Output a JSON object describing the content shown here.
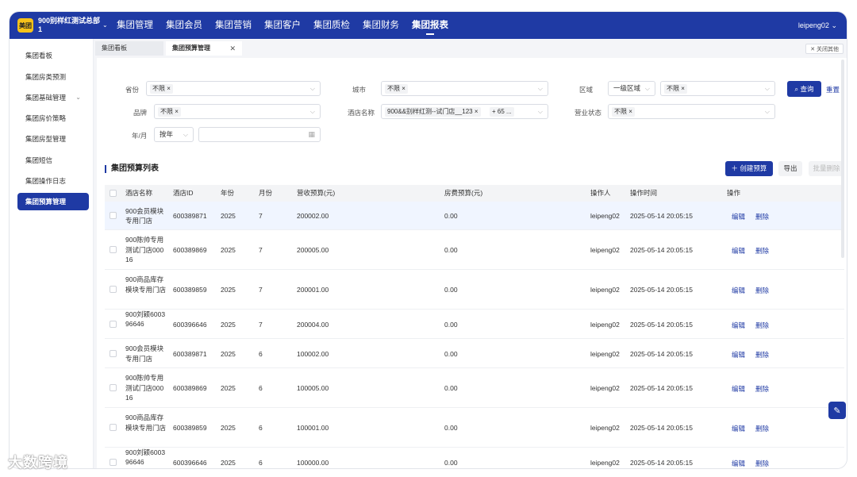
{
  "header": {
    "logo": "美团",
    "org": "900别样红测试总部1",
    "nav": [
      "集团管理",
      "集团会员",
      "集团营销",
      "集团客户",
      "集团质检",
      "集团财务",
      "集团报表"
    ],
    "active_nav": "集团报表",
    "user": "leipeng02",
    "accent": "#1f3aa4"
  },
  "sidebar": {
    "items": [
      "集团看板",
      "集团房类预测",
      "集团基础管理",
      "集团房价策略",
      "集团房型管理",
      "集团短信",
      "集团操作日志",
      "集团预算管理"
    ],
    "active": "集团预算管理"
  },
  "tabs": {
    "items": [
      "集团看板",
      "集团预算管理"
    ],
    "close_others": "关闭其他"
  },
  "filters": {
    "province_label": "省份",
    "province_value": "不限",
    "city_label": "城市",
    "city_value": "不限",
    "region_label": "区域",
    "region_level": "一级区域",
    "region_value": "不限",
    "brand_label": "品牌",
    "brand_value": "不限",
    "hotel_label": "酒店名称",
    "hotel_value": "900&&别样红测--试门店__123",
    "hotel_more": "+ 65 ...",
    "status_label": "营业状态",
    "status_value": "不限",
    "yearmonth_label": "年/月",
    "yearmonth_mode": "按年",
    "query_button": "查询",
    "reset_button": "重置"
  },
  "list": {
    "title": "集团预算列表",
    "create_button": "创建预算",
    "export_button": "导出",
    "batch_delete_button": "批量删除",
    "columns": [
      "酒店名称",
      "酒店ID",
      "年份",
      "月份",
      "营收预算(元)",
      "房费预算(元)",
      "操作人",
      "操作时间",
      "操作"
    ],
    "rows": [
      {
        "name": "900会员模块专用门店",
        "id": "600389871",
        "year": "2025",
        "month": "7",
        "revenue": "200002.00",
        "room": "0.00",
        "operator": "leipeng02",
        "time": "2025-05-14 20:05:15"
      },
      {
        "name": "900陈帅专用测试门店00016",
        "id": "600389869",
        "year": "2025",
        "month": "7",
        "revenue": "200005.00",
        "room": "0.00",
        "operator": "leipeng02",
        "time": "2025-05-14 20:05:15"
      },
      {
        "name": "900商品库存模块专用门店",
        "id": "600389859",
        "year": "2025",
        "month": "7",
        "revenue": "200001.00",
        "room": "0.00",
        "operator": "leipeng02",
        "time": "2025-05-14 20:05:15"
      },
      {
        "name": "900刘颖600396646",
        "id": "600396646",
        "year": "2025",
        "month": "7",
        "revenue": "200004.00",
        "room": "0.00",
        "operator": "leipeng02",
        "time": "2025-05-14 20:05:15"
      },
      {
        "name": "900会员模块专用门店",
        "id": "600389871",
        "year": "2025",
        "month": "6",
        "revenue": "100002.00",
        "room": "0.00",
        "operator": "leipeng02",
        "time": "2025-05-14 20:05:15"
      },
      {
        "name": "900陈帅专用测试门店00016",
        "id": "600389869",
        "year": "2025",
        "month": "6",
        "revenue": "100005.00",
        "room": "0.00",
        "operator": "leipeng02",
        "time": "2025-05-14 20:05:15"
      },
      {
        "name": "900商品库存模块专用门店",
        "id": "600389859",
        "year": "2025",
        "month": "6",
        "revenue": "100001.00",
        "room": "0.00",
        "operator": "leipeng02",
        "time": "2025-05-14 20:05:15"
      },
      {
        "name": "900刘颖600396646",
        "id": "600396646",
        "year": "2025",
        "month": "6",
        "revenue": "100000.00",
        "room": "0.00",
        "operator": "leipeng02",
        "time": "2025-05-14 20:05:15"
      }
    ],
    "edit_label": "编辑",
    "delete_label": "删除"
  },
  "brand_watermark": "大数跨境"
}
